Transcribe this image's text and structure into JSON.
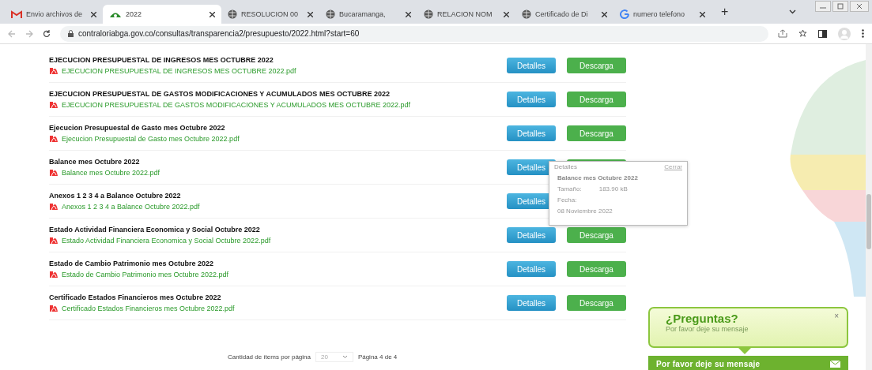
{
  "browser": {
    "tabs": [
      {
        "title": "Envio archivos de",
        "selected": false
      },
      {
        "title": "2022",
        "selected": true
      },
      {
        "title": "RESOLUCION 00",
        "selected": false
      },
      {
        "title": "Bucaramanga,",
        "selected": false
      },
      {
        "title": "RELACION NOM",
        "selected": false
      },
      {
        "title": "Certificado de Di",
        "selected": false
      },
      {
        "title": "numero telefono",
        "selected": false
      }
    ],
    "new_tab": "+",
    "url": "contraloriabga.gov.co/consultas/transparencia2/presupuesto/2022.html?start=60"
  },
  "documents": [
    {
      "title": "EJECUCION PRESUPUESTAL DE INGRESOS MES OCTUBRE 2022",
      "file": "EJECUCION PRESUPUESTAL DE INGRESOS MES OCTUBRE 2022.pdf",
      "details": "Detalles",
      "download": "Descarga"
    },
    {
      "title": "EJECUCION PRESUPUESTAL DE GASTOS MODIFICACIONES Y ACUMULADOS MES OCTUBRE 2022",
      "file": "EJECUCION PRESUPUESTAL DE GASTOS MODIFICACIONES Y ACUMULADOS MES OCTUBRE 2022.pdf",
      "details": "Detalles",
      "download": "Descarga"
    },
    {
      "title": "Ejecucion Presupuestal de Gasto mes Octubre 2022",
      "file": "Ejecucion Presupuestal de Gasto mes Octubre 2022.pdf",
      "details": "Detalles",
      "download": "Descarga"
    },
    {
      "title": "Balance mes Octubre 2022",
      "file": "Balance mes Octubre 2022.pdf",
      "details": "Detalles"
    },
    {
      "title": "Anexos 1 2 3 4 a Balance Octubre 2022",
      "file": "Anexos 1 2 3 4 a Balance Octubre 2022.pdf",
      "details": "Detalles"
    },
    {
      "title": "Estado Actividad Financiera Economica y Social Octubre 2022",
      "file": "Estado Actividad Financiera Economica y Social Octubre 2022.pdf",
      "details": "Detalles",
      "download": "Descarga"
    },
    {
      "title": "Estado de Cambio Patrimonio mes Octubre 2022",
      "file": "Estado de Cambio Patrimonio mes Octubre 2022.pdf",
      "details": "Detalles",
      "download": "Descarga"
    },
    {
      "title": "Certificado Estados Financieros mes Octubre 2022",
      "file": "Certificado Estados Financieros mes Octubre 2022.pdf",
      "details": "Detalles",
      "download": "Descarga"
    }
  ],
  "details_popup": {
    "heading": "Detalles",
    "close": "Cerrar",
    "title": "Balance mes Octubre 2022",
    "size_label": "Tamaño:",
    "size": "183.90 kB",
    "date_label": "Fecha:",
    "date": "08 Noviembre 2022"
  },
  "pagination": {
    "items_label": "Cantidad de ítems por página",
    "items_per_page": "20",
    "page": "Página 4 de 4"
  },
  "chat": {
    "heading": "¿Preguntas?",
    "message": "Por favor deje su mensaje",
    "close": "×",
    "bar_label": "Por favor deje su mensaje"
  }
}
